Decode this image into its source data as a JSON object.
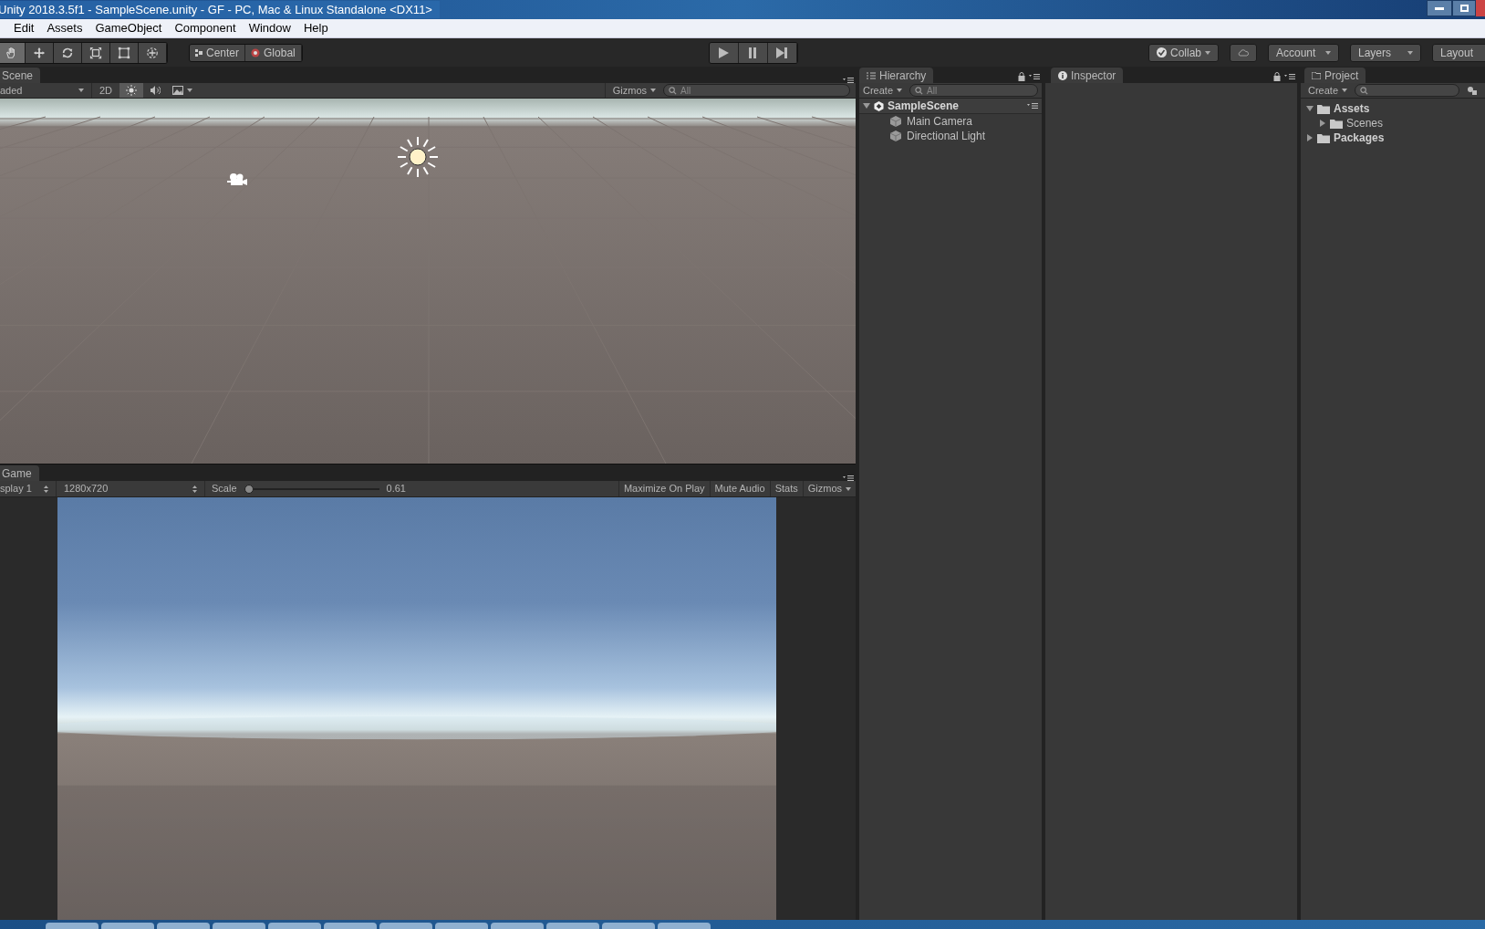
{
  "window": {
    "title": "Unity 2018.3.5f1 - SampleScene.unity - GF - PC, Mac & Linux Standalone <DX11>"
  },
  "menu": [
    "Edit",
    "Assets",
    "GameObject",
    "Component",
    "Window",
    "Help"
  ],
  "toolbar": {
    "tools": [
      {
        "kind": "hand",
        "selected": true
      },
      {
        "kind": "move",
        "selected": false
      },
      {
        "kind": "rotate",
        "selected": false
      },
      {
        "kind": "scale",
        "selected": false
      },
      {
        "kind": "rect",
        "selected": false
      },
      {
        "kind": "transform",
        "selected": false
      }
    ],
    "pivot": [
      "Center",
      "Global"
    ],
    "right": [
      {
        "kind": "collab",
        "label": "Collab"
      },
      {
        "kind": "cloud"
      },
      {
        "kind": "dropdown",
        "label": "Account"
      },
      {
        "kind": "dropdown",
        "label": "Layers"
      },
      {
        "kind": "dropdown",
        "label": "Layout"
      }
    ]
  },
  "scene": {
    "tab": "Scene",
    "shading": "aded",
    "mode_2d": "2D",
    "lighting_on": true,
    "gizmos": "Gizmos",
    "search_placeholder": "All"
  },
  "game": {
    "tab": "Game",
    "display": "splay 1",
    "resolution": "1280x720",
    "scale_label": "Scale",
    "scale": {
      "level": 0.0
    },
    "scale_reading": "0.61",
    "buttons": [
      "Maximize On Play",
      "Mute Audio",
      "Stats"
    ],
    "gizmos": "Gizmos"
  },
  "hierarchy": {
    "tab": "Hierarchy",
    "create": "Create",
    "search_placeholder": "All",
    "scene": {
      "name": "SampleScene",
      "expanded": true,
      "children": [
        {
          "name": "Main Camera"
        },
        {
          "name": "Directional Light"
        }
      ]
    }
  },
  "inspector": {
    "tab": "Inspector"
  },
  "project": {
    "tab": "Project",
    "create": "Create",
    "tree": [
      {
        "name": "Assets",
        "expanded": true,
        "children": [
          {
            "name": "Scenes",
            "expanded": false
          }
        ]
      },
      {
        "name": "Packages",
        "expanded": false
      }
    ]
  }
}
